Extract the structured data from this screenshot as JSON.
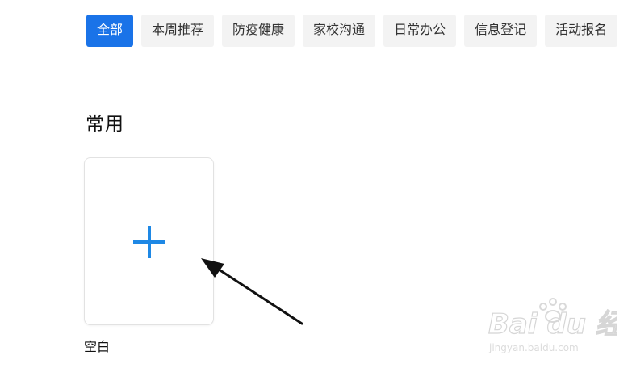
{
  "tabs": [
    {
      "label": "全部",
      "active": true
    },
    {
      "label": "本周推荐",
      "active": false
    },
    {
      "label": "防疫健康",
      "active": false
    },
    {
      "label": "家校沟通",
      "active": false
    },
    {
      "label": "日常办公",
      "active": false
    },
    {
      "label": "信息登记",
      "active": false
    },
    {
      "label": "活动报名",
      "active": false
    }
  ],
  "section": {
    "title": "常用"
  },
  "blank_template": {
    "label": "空白",
    "icon": "plus-icon"
  },
  "watermark": {
    "brand": "Bai du 经验",
    "url": "jingyan.baidu.com"
  },
  "colors": {
    "accent": "#1a73e8",
    "plus": "#1e88e5",
    "tab_bg": "#f3f3f3",
    "arrow": "#111111"
  }
}
